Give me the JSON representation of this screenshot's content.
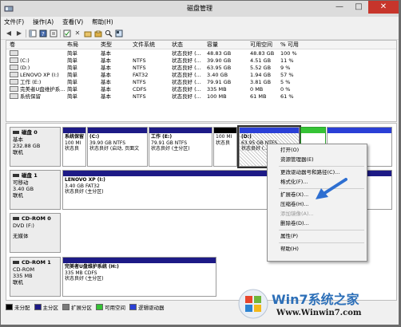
{
  "window": {
    "title": "磁盘管理"
  },
  "menu": [
    "文件(F)",
    "操作(A)",
    "查看(V)",
    "帮助(H)"
  ],
  "volume_table": {
    "columns": [
      "卷",
      "布局",
      "类型",
      "文件系统",
      "状态",
      "容量",
      "可用空间",
      "% 可用"
    ],
    "rows": [
      [
        "",
        "简单",
        "基本",
        "",
        "状态良好 (...",
        "48.83 GB",
        "48.83 GB",
        "100 %"
      ],
      [
        "(C:)",
        "简单",
        "基本",
        "NTFS",
        "状态良好 (...",
        "39.90 GB",
        "4.51 GB",
        "11 %"
      ],
      [
        "(D:)",
        "简单",
        "基本",
        "NTFS",
        "状态良好 (...",
        "63.95 GB",
        "5.52 GB",
        "9 %"
      ],
      [
        "LENOVO XP (I:)",
        "简单",
        "基本",
        "FAT32",
        "状态良好 (...",
        "3.40 GB",
        "1.94 GB",
        "57 %"
      ],
      [
        "工作 (E:)",
        "简单",
        "基本",
        "NTFS",
        "状态良好 (...",
        "79.91 GB",
        "3.81 GB",
        "5 %"
      ],
      [
        "完美者U盘维护系...",
        "简单",
        "基本",
        "CDFS",
        "状态良好 (...",
        "335 MB",
        "0 MB",
        "0 %"
      ],
      [
        "系统保留",
        "简单",
        "基本",
        "NTFS",
        "状态良好 (...",
        "100 MB",
        "61 MB",
        "61 %"
      ]
    ]
  },
  "disks": [
    {
      "name": "磁盘 0",
      "type": "基本",
      "size": "232.88 GB",
      "status": "联机"
    },
    {
      "name": "磁盘 1",
      "type": "可移动",
      "size": "3.40 GB",
      "status": "联机"
    },
    {
      "name": "CD-ROM 0",
      "type": "DVD (F:)",
      "size": "",
      "status": "无媒体"
    },
    {
      "name": "CD-ROM 1",
      "type": "CD-ROM",
      "size": "335 MB",
      "status": "联机"
    }
  ],
  "partitions": {
    "d0_sys": {
      "name": "系统保留",
      "size": "100 MI",
      "status": "状态良"
    },
    "d0_c": {
      "name": "(C:)",
      "size": "39.90 GB NTFS",
      "status": "状态良好 (启动, 页面文"
    },
    "d0_e": {
      "name": "工作 (E:)",
      "size": "79.91 GB NTFS",
      "status": "状态良好 (主分区)"
    },
    "d0_free": {
      "name": "",
      "size": "100 MI",
      "status": "状态良"
    },
    "d0_d": {
      "name": "(D:)",
      "size": "63.95 GB NTFS",
      "status": "状态良好 (..."
    },
    "d1_i": {
      "name": "LENOVO XP (I:)",
      "size": "3.40 GB FAT32",
      "status": "状态良好 (主分区)"
    },
    "cd1": {
      "name": "完美者U盘维护系统 (H:)",
      "size": "335 MB CDFS",
      "status": "状态良好 (主分区)"
    }
  },
  "context_menu": [
    {
      "label": "打开(O)",
      "disabled": false
    },
    {
      "label": "资源管理器(E)",
      "disabled": false
    },
    {
      "label": "更改驱动器号和路径(C)...",
      "disabled": false
    },
    {
      "label": "格式化(F)...",
      "disabled": false
    },
    {
      "label": "扩展卷(X)...",
      "disabled": false
    },
    {
      "label": "压缩卷(H)...",
      "disabled": false
    },
    {
      "label": "添加镜像(A)...",
      "disabled": true
    },
    {
      "label": "删除卷(D)...",
      "disabled": false
    },
    {
      "label": "属性(P)",
      "disabled": false
    },
    {
      "label": "帮助(H)",
      "disabled": false
    }
  ],
  "legend": [
    {
      "label": "未分配",
      "color": "#000000"
    },
    {
      "label": "主分区",
      "color": "#1d1a86"
    },
    {
      "label": "扩展分区",
      "color": "#7b7b7b"
    },
    {
      "label": "可用空间",
      "color": "#35c335"
    },
    {
      "label": "逻辑驱动器",
      "color": "#2a3fd6"
    }
  ],
  "watermark": {
    "brand": "Win7系统之家",
    "url": "Www.Winwin7.com"
  },
  "colors": {
    "primary": "#1d1a86",
    "logical": "#2a3fd6",
    "free": "#35c335",
    "unallocated": "#000000",
    "arrow": "#2e6fd1"
  }
}
